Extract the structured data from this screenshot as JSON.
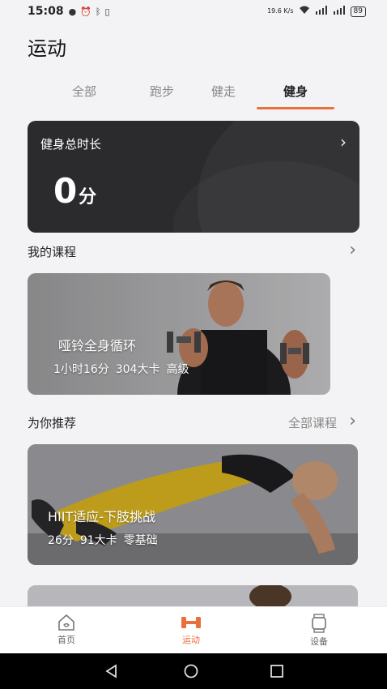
{
  "status": {
    "time": "15:08",
    "net_speed": "19.6 K/s",
    "battery": "89"
  },
  "page": {
    "title": "运动"
  },
  "tabs": [
    {
      "label": "全部"
    },
    {
      "label": "跑步"
    },
    {
      "label": "健走"
    },
    {
      "label": "健身"
    }
  ],
  "total": {
    "label": "健身总时长",
    "value": "0",
    "unit": "分"
  },
  "my_courses": {
    "title": "我的课程",
    "course": {
      "name": "哑铃全身循环",
      "duration": "1小时16分",
      "calories": "304大卡",
      "level": "高级"
    }
  },
  "recommend": {
    "title": "为你推荐",
    "more_label": "全部课程",
    "course": {
      "name": "HIIT适应-下肢挑战",
      "duration": "26分",
      "calories": "91大卡",
      "level": "零基础"
    }
  },
  "bottom_nav": [
    {
      "label": "首页"
    },
    {
      "label": "运动"
    },
    {
      "label": "设备"
    }
  ],
  "colors": {
    "accent": "#e8703a",
    "card_dark": "#2b2b2d"
  }
}
